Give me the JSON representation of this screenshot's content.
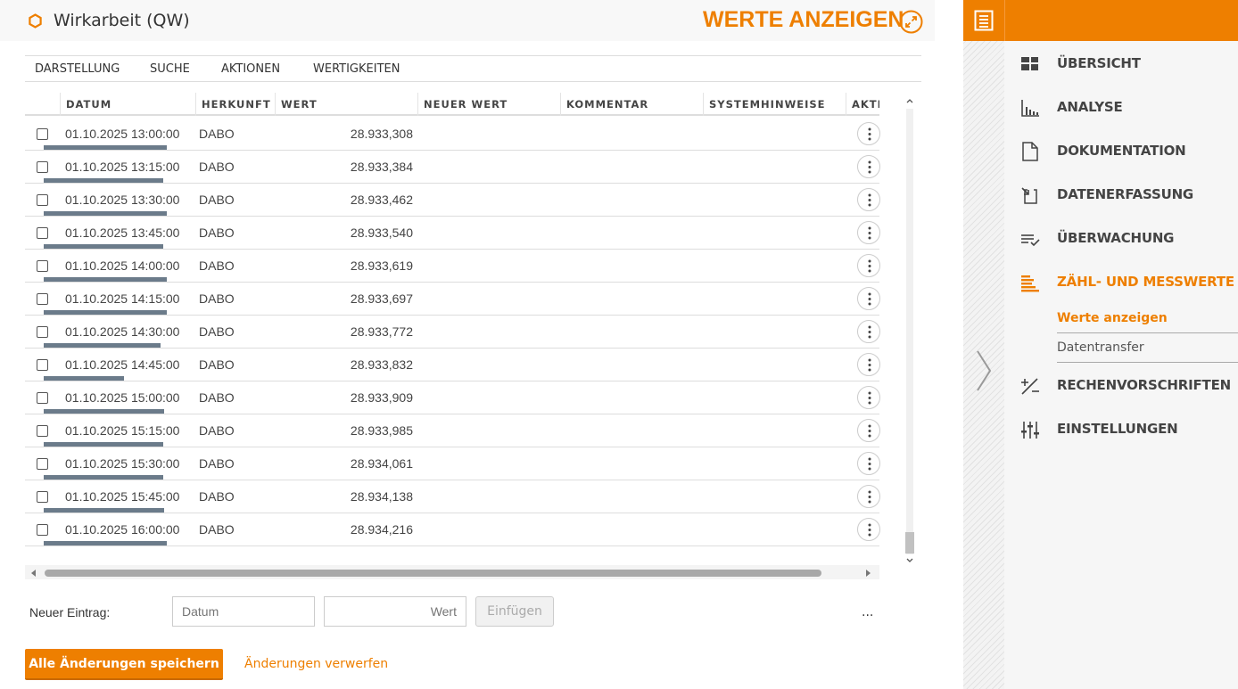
{
  "header": {
    "title": "Wirkarbeit (QW)",
    "page_heading": "WERTE ANZEIGEN",
    "accent_color": "#ee7f00"
  },
  "menu": [
    "DARSTELLUNG",
    "SUCHE",
    "AKTIONEN",
    "WERTIGKEITEN"
  ],
  "table": {
    "columns": [
      "DATUM",
      "HERKUNFT",
      "WERT",
      "NEUER WERT",
      "KOMMENTAR",
      "SYSTEMHINWEISE",
      "AKTI"
    ],
    "rows": [
      {
        "date": "01.10.2025 13:00:00",
        "origin": "DABO",
        "value": "28.933,308",
        "quality": 1.0
      },
      {
        "date": "01.10.2025 13:15:00",
        "origin": "DABO",
        "value": "28.933,384",
        "quality": 0.97
      },
      {
        "date": "01.10.2025 13:30:00",
        "origin": "DABO",
        "value": "28.933,462",
        "quality": 1.0
      },
      {
        "date": "01.10.2025 13:45:00",
        "origin": "DABO",
        "value": "28.933,540",
        "quality": 0.97
      },
      {
        "date": "01.10.2025 14:00:00",
        "origin": "DABO",
        "value": "28.933,619",
        "quality": 1.0
      },
      {
        "date": "01.10.2025 14:15:00",
        "origin": "DABO",
        "value": "28.933,697",
        "quality": 1.0
      },
      {
        "date": "01.10.2025 14:30:00",
        "origin": "DABO",
        "value": "28.933,772",
        "quality": 0.95
      },
      {
        "date": "01.10.2025 14:45:00",
        "origin": "DABO",
        "value": "28.933,832",
        "quality": 0.65
      },
      {
        "date": "01.10.2025 15:00:00",
        "origin": "DABO",
        "value": "28.933,909",
        "quality": 0.98
      },
      {
        "date": "01.10.2025 15:15:00",
        "origin": "DABO",
        "value": "28.933,985",
        "quality": 0.97
      },
      {
        "date": "01.10.2025 15:30:00",
        "origin": "DABO",
        "value": "28.934,061",
        "quality": 0.97
      },
      {
        "date": "01.10.2025 15:45:00",
        "origin": "DABO",
        "value": "28.934,138",
        "quality": 0.98
      },
      {
        "date": "01.10.2025 16:00:00",
        "origin": "DABO",
        "value": "28.934,216",
        "quality": 1.0
      }
    ]
  },
  "new_entry": {
    "label": "Neuer Eintrag:",
    "date_placeholder": "Datum",
    "value_placeholder": "Wert",
    "insert_label": "Einfügen",
    "more": "..."
  },
  "footer": {
    "save_label": "Alle Änderungen speichern",
    "discard_label": "Änderungen verwerfen"
  },
  "sidebar": {
    "items": [
      {
        "label": "ÜBERSICHT",
        "icon": "dashboard-icon",
        "active": false
      },
      {
        "label": "ANALYSE",
        "icon": "bar-chart-icon",
        "active": false
      },
      {
        "label": "DOKUMENTATION",
        "icon": "document-icon",
        "active": false
      },
      {
        "label": "DATENERFASSUNG",
        "icon": "data-entry-icon",
        "active": false
      },
      {
        "label": "ÜBERWACHUNG",
        "icon": "checklist-icon",
        "active": false
      },
      {
        "label": "ZÄHL- UND MESSWERTE",
        "icon": "meter-values-icon",
        "active": true
      },
      {
        "label": "RECHENVORSCHRIFTEN",
        "icon": "calculation-icon",
        "active": false
      },
      {
        "label": "EINSTELLUNGEN",
        "icon": "sliders-icon",
        "active": false
      }
    ],
    "subitems": [
      {
        "label": "Werte anzeigen",
        "active": true
      },
      {
        "label": "Datentransfer",
        "active": false
      }
    ]
  }
}
